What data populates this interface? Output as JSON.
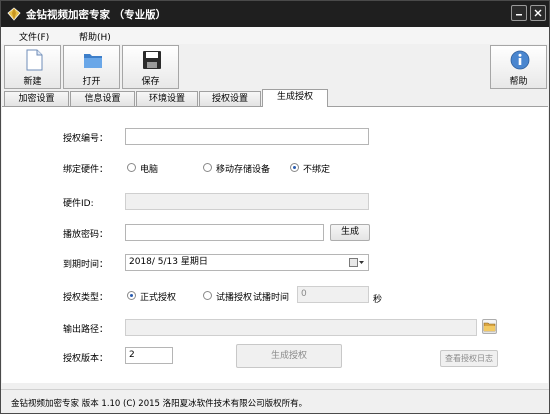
{
  "window": {
    "title": "金钻视频加密专家 （专业版）",
    "controls": {
      "minimize": "–",
      "close": "×"
    }
  },
  "menu": [
    {
      "label": "文件(F)"
    },
    {
      "label": "帮助(H)"
    }
  ],
  "toolbar": {
    "new_label": "新建",
    "open_label": "打开",
    "save_label": "保存",
    "help_label": "帮助"
  },
  "tabs": [
    {
      "label": "加密设置"
    },
    {
      "label": "信息设置"
    },
    {
      "label": "环境设置"
    },
    {
      "label": "授权设置"
    },
    {
      "label": "生成授权",
      "active": true
    }
  ],
  "form": {
    "auth_number": {
      "label": "授权编号：",
      "value": ""
    },
    "bind_hardware": {
      "label": "绑定硬件：",
      "options": [
        {
          "label": "电脑",
          "checked": false
        },
        {
          "label": "移动存储设备",
          "checked": false
        },
        {
          "label": "不绑定",
          "checked": true
        }
      ]
    },
    "hardware_id": {
      "label": "硬件ID:",
      "value": ""
    },
    "play_password": {
      "label": "播放密码：",
      "value": "",
      "generate_label": "生成"
    },
    "expiry": {
      "label": "到期时间：",
      "value": "2018/  5/13 星期日"
    },
    "auth_type": {
      "label": "授权类型：",
      "options": [
        {
          "label": "正式授权",
          "checked": true
        },
        {
          "label": "试播授权",
          "checked": false
        }
      ],
      "trial_label": "试播时间",
      "trial_value": "0",
      "trial_unit": "秒"
    },
    "output_path": {
      "label": "输出路径：",
      "value": ""
    },
    "auth_version": {
      "label": "授权版本：",
      "value": "2"
    },
    "generate_button": "生成授权",
    "log_button": "查看授权日志"
  },
  "status": {
    "text": "金钻视频加密专家  版本 1.10 (C)  2015 洛阳夏冰软件技术有限公司版权所有。"
  },
  "colors": {
    "titlebar": "#1f1f1f",
    "accent_blue": "#2a5db0",
    "disabled_text": "#8a8a8a"
  }
}
